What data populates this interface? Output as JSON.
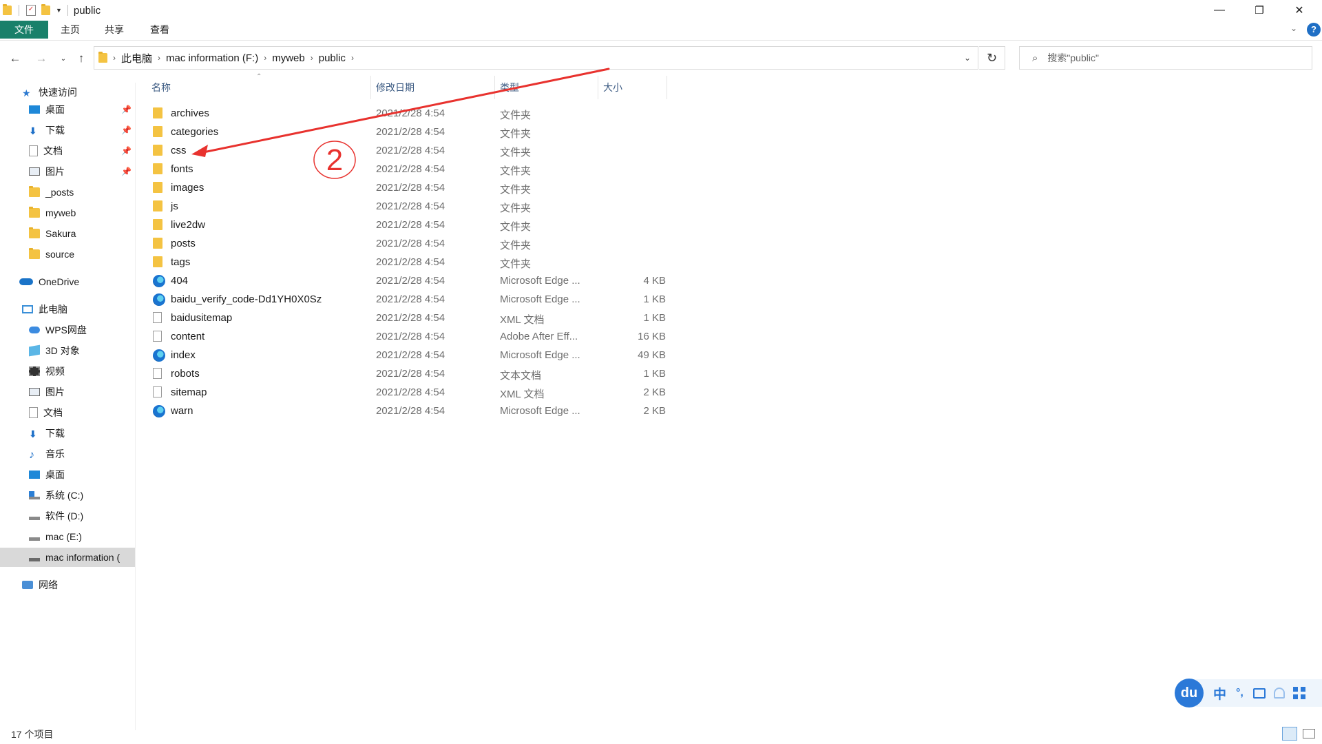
{
  "window": {
    "title": "public",
    "minimize": "—",
    "maximize": "❐",
    "close": "✕"
  },
  "ribbon": {
    "tabs": [
      "文件",
      "主页",
      "共享",
      "查看"
    ],
    "help": "?"
  },
  "nav": {
    "breadcrumb": [
      "此电脑",
      "mac information (F:)",
      "myweb",
      "public"
    ],
    "search_placeholder": "搜索\"public\""
  },
  "sidebar": {
    "quick_access": "快速访问",
    "quick_items": [
      "桌面",
      "下载",
      "文档",
      "图片",
      "_posts",
      "myweb",
      "Sakura",
      "source"
    ],
    "onedrive": "OneDrive",
    "this_pc": "此电脑",
    "pc_items": [
      "WPS网盘",
      "3D 对象",
      "视频",
      "图片",
      "文档",
      "下载",
      "音乐",
      "桌面",
      "系统 (C:)",
      "软件 (D:)",
      "mac (E:)",
      "mac information ("
    ],
    "network": "网络"
  },
  "columns": {
    "name": "名称",
    "modified": "修改日期",
    "type": "类型",
    "size": "大小"
  },
  "files": [
    {
      "name": "archives",
      "date": "2021/2/28 4:54",
      "type": "文件夹",
      "size": "",
      "icon": "folder"
    },
    {
      "name": "categories",
      "date": "2021/2/28 4:54",
      "type": "文件夹",
      "size": "",
      "icon": "folder"
    },
    {
      "name": "css",
      "date": "2021/2/28 4:54",
      "type": "文件夹",
      "size": "",
      "icon": "folder"
    },
    {
      "name": "fonts",
      "date": "2021/2/28 4:54",
      "type": "文件夹",
      "size": "",
      "icon": "folder"
    },
    {
      "name": "images",
      "date": "2021/2/28 4:54",
      "type": "文件夹",
      "size": "",
      "icon": "folder"
    },
    {
      "name": "js",
      "date": "2021/2/28 4:54",
      "type": "文件夹",
      "size": "",
      "icon": "folder"
    },
    {
      "name": "live2dw",
      "date": "2021/2/28 4:54",
      "type": "文件夹",
      "size": "",
      "icon": "folder"
    },
    {
      "name": "posts",
      "date": "2021/2/28 4:54",
      "type": "文件夹",
      "size": "",
      "icon": "folder"
    },
    {
      "name": "tags",
      "date": "2021/2/28 4:54",
      "type": "文件夹",
      "size": "",
      "icon": "folder"
    },
    {
      "name": "404",
      "date": "2021/2/28 4:54",
      "type": "Microsoft Edge ...",
      "size": "4 KB",
      "icon": "edge"
    },
    {
      "name": "baidu_verify_code-Dd1YH0X0Sz",
      "date": "2021/2/28 4:54",
      "type": "Microsoft Edge ...",
      "size": "1 KB",
      "icon": "edge"
    },
    {
      "name": "baidusitemap",
      "date": "2021/2/28 4:54",
      "type": "XML 文档",
      "size": "1 KB",
      "icon": "doc"
    },
    {
      "name": "content",
      "date": "2021/2/28 4:54",
      "type": "Adobe After Eff...",
      "size": "16 KB",
      "icon": "doc"
    },
    {
      "name": "index",
      "date": "2021/2/28 4:54",
      "type": "Microsoft Edge ...",
      "size": "49 KB",
      "icon": "edge"
    },
    {
      "name": "robots",
      "date": "2021/2/28 4:54",
      "type": "文本文档",
      "size": "1 KB",
      "icon": "doc"
    },
    {
      "name": "sitemap",
      "date": "2021/2/28 4:54",
      "type": "XML 文档",
      "size": "2 KB",
      "icon": "doc"
    },
    {
      "name": "warn",
      "date": "2021/2/28 4:54",
      "type": "Microsoft Edge ...",
      "size": "2 KB",
      "icon": "edge"
    }
  ],
  "annotation": {
    "label": "2",
    "color": "#e8322e"
  },
  "status": {
    "count": "17 个项目"
  },
  "ime": {
    "logo": "du",
    "mode": "中",
    "punct": "°,"
  },
  "colors": {
    "accent": "#19806a",
    "header_text": "#3b5a82",
    "selected": "#d9d9d9"
  }
}
